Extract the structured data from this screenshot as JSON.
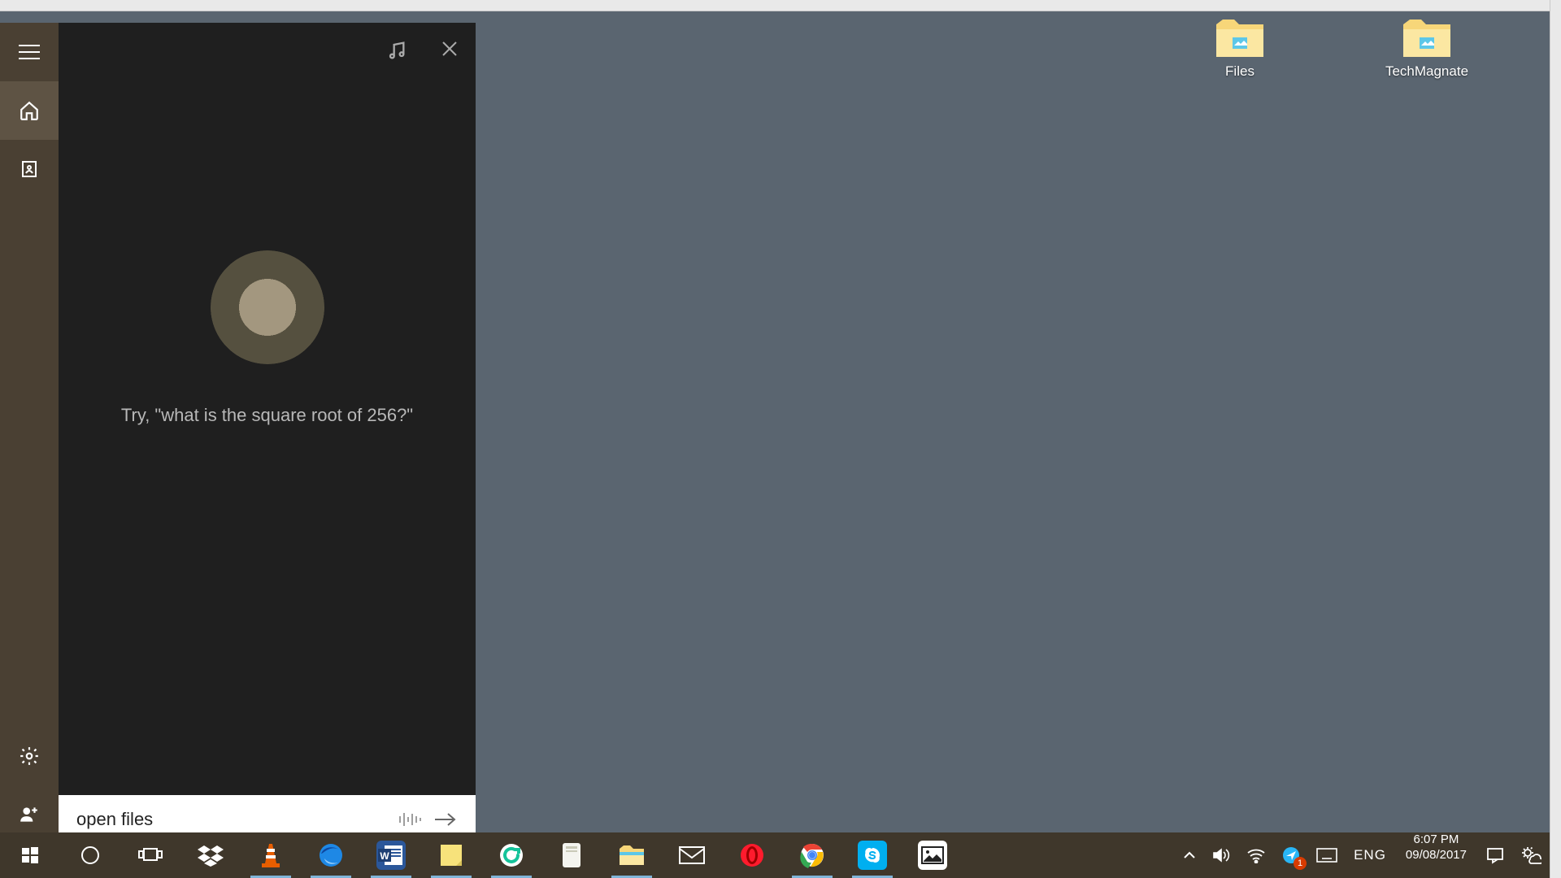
{
  "desktop": {
    "icons": [
      {
        "label": "Files"
      },
      {
        "label": "TechMagnate"
      }
    ]
  },
  "cortana": {
    "hint": "Try, \"what is the square root of 256?\"",
    "search_value": "open files"
  },
  "taskbar": {
    "apps": {
      "start": "Start",
      "cortana": "Cortana",
      "taskview": "Task View",
      "dropbox": "Dropbox",
      "vlc": "VLC media player",
      "edge": "Microsoft Edge",
      "word": "Microsoft Word",
      "stickynotes": "Sticky Notes",
      "grammarly": "Grammarly",
      "epub": "eReader",
      "explorer": "File Explorer",
      "mail": "Mail",
      "opera": "Opera",
      "chrome": "Google Chrome",
      "skype": "Skype",
      "photos": "Photos"
    },
    "tray": {
      "language": "ENG",
      "time": "6:07 PM",
      "date": "09/08/2017",
      "location_badge": "1"
    }
  }
}
